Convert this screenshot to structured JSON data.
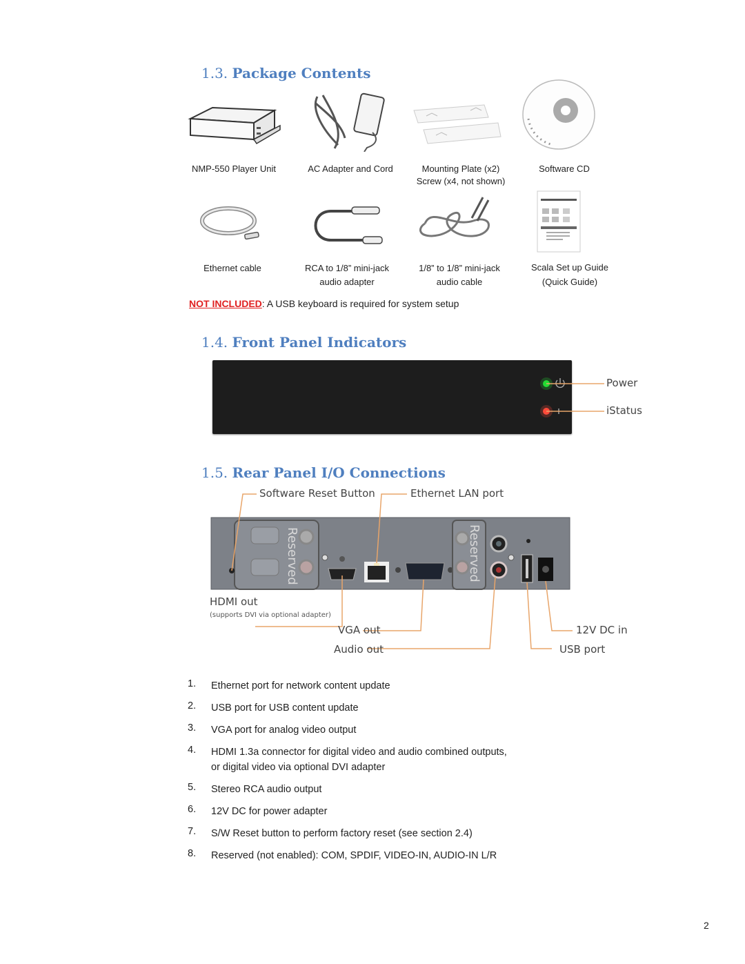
{
  "colors": {
    "heading": "#4f7fbf",
    "not_included": "#e02020",
    "callout_line": "#e8a56a",
    "led_power": "#22dd33",
    "led_status": "#ff4a3a"
  },
  "sections": {
    "package": {
      "number": "1.3.",
      "title": "Package Contents",
      "items": [
        {
          "label": "NMP-550 Player Unit",
          "icon": "player-unit-image"
        },
        {
          "label": "AC Adapter and Cord",
          "icon": "ac-adapter-image"
        },
        {
          "label": "Mounting Plate (x2)",
          "label2": "Screw (x4, not shown)",
          "icon": "mounting-plate-image"
        },
        {
          "label": "Software CD",
          "icon": "cd-image"
        },
        {
          "label": "Ethernet cable",
          "icon": "ethernet-cable-image"
        },
        {
          "label": "RCA to 1/8” mini-jack",
          "label2": "audio adapter",
          "icon": "rca-adapter-image"
        },
        {
          "label": "1/8” to 1/8” mini-jack",
          "label2": "audio cable",
          "icon": "audio-cable-image"
        },
        {
          "label": "Scala Set up Guide",
          "label2": "(Quick Guide)",
          "icon": "quick-guide-image"
        }
      ],
      "note_label": "NOT INCLUDED",
      "note_text": ": A USB keyboard is required for system setup"
    },
    "front": {
      "number": "1.4.",
      "title": "Front Panel Indicators",
      "indicators": [
        {
          "label": "Power",
          "icon": "power-icon"
        },
        {
          "label": "iStatus",
          "icon": "status-icon"
        }
      ]
    },
    "rear": {
      "number": "1.5.",
      "title": "Rear Panel I/O Connections",
      "panel_reserved_label": "Reserved",
      "callouts": {
        "reset": "Software Reset Button",
        "lan": "Ethernet LAN port",
        "hdmi": "HDMI out",
        "hdmi_sub": "(supports DVI via optional adapter)",
        "vga": "VGA out",
        "audio": "Audio out",
        "dc": "12V DC in",
        "usb": "USB port"
      },
      "list": [
        {
          "n": "1.",
          "text": "Ethernet port for network content update"
        },
        {
          "n": "2.",
          "text": "USB port for USB content update"
        },
        {
          "n": "3.",
          "text": "VGA port for analog video output"
        },
        {
          "n": "4.",
          "text": "HDMI 1.3a connector for digital video and audio combined outputs,",
          "text2": "or digital video via optional DVI adapter"
        },
        {
          "n": "5.",
          "text": "Stereo RCA audio output"
        },
        {
          "n": "6.",
          "text": "12V DC for power adapter"
        },
        {
          "n": "7.",
          "text": "S/W Reset button to perform factory reset (see section 2.4)"
        },
        {
          "n": "8.",
          "text": "Reserved (not enabled): COM, SPDIF, VIDEO-IN, AUDIO-IN L/R"
        }
      ]
    }
  },
  "page_number": "2"
}
